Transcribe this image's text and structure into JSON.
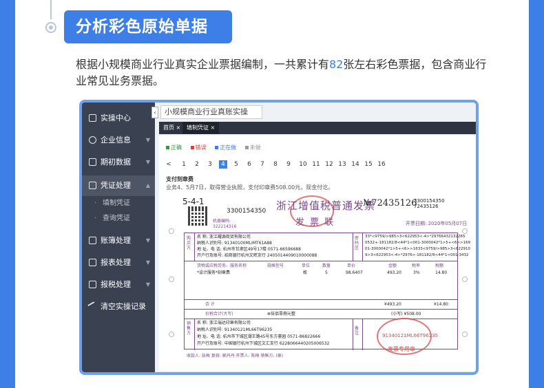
{
  "header": {
    "badge": "分析彩色原始单据",
    "desc_pre": "根据小规模商业行业真实企业票据编制，一共累计有",
    "desc_num": "82",
    "desc_post": "张左右彩色票据，包含商业行业常见业务票据。"
  },
  "app": {
    "tooltip": "小规模商业行业真账实操",
    "collapse_icon": "chevron-left-icon",
    "nav": [
      {
        "label": "实操中心",
        "icon": "check-square-icon"
      },
      {
        "label": "企业信息",
        "icon": "building-icon"
      },
      {
        "label": "期初数据",
        "icon": "bar-chart-icon"
      },
      {
        "label": "凭证处理",
        "icon": "document-icon"
      },
      {
        "label": "账簿处理",
        "icon": "book-icon"
      },
      {
        "label": "报表处理",
        "icon": "line-chart-icon"
      },
      {
        "label": "报税处理",
        "icon": "tax-icon"
      },
      {
        "label": "清空实操记录",
        "icon": "eraser-icon"
      }
    ],
    "nav_sub": [
      "填制凭证",
      "查询凭证"
    ],
    "tabs": [
      {
        "label": "首页 ×"
      },
      {
        "label": "填制凭证 ×"
      }
    ],
    "legend": [
      {
        "label": "正确",
        "color": "#22a33a"
      },
      {
        "label": "错误",
        "color": "#e23b3b"
      },
      {
        "label": "正在做",
        "color": "#3d7fe6"
      },
      {
        "label": "未做",
        "color": "#999999"
      }
    ],
    "pager": {
      "prev": "<",
      "pages": [
        "1",
        "2",
        "3",
        "4",
        "5",
        "6",
        "7",
        "8",
        "9",
        "10",
        "11",
        "12",
        "13",
        "14",
        "15",
        "16"
      ],
      "active": "4"
    },
    "info_title": "支付刻章费",
    "info_text": "业务4、5月7日，取得营业执照，支付印章费508.00元，现金付讫。"
  },
  "invoice": {
    "code_left": "5-4-1",
    "code_num": "3300154350",
    "title": "浙江增值税普通发票",
    "subtitle": "发 票 联",
    "no_label": "№72435126",
    "no_small": "3300154350\n72435126",
    "machine": "机器编码:\n322214316",
    "date": "开票日期: 2020年05月07日",
    "buyer": {
      "name": "名    称: 浙江耀源商贸有限公司",
      "tax": "纳税人识别号: 91340100MLIMT61A88",
      "addr": "地 址、电 话: 杭州市甘肃区49号17楼 0571-66596688",
      "bank": "开户行及账号: 招商银行杭州文晖支行 2405014409010000088"
    },
    "cipher": [
      "33*<9759/>985>3<622953<-4>*29766432132265",
      "0532+-181182/8<44*1<001-3000042*1>5+<6>>169",
      "01-3000042*1>5+<6>>1633<9759/>985>3<622910",
      "9>3<622953<-4>*2976>-181182/8<44*1<001-3432"
    ],
    "columns": [
      "货物或应税劳务、服务名称",
      "规格型号",
      "单位",
      "数量",
      "单价",
      "金额",
      "税率",
      "税额"
    ],
    "row": [
      "*设计服务*刻章费",
      "",
      "枚",
      "5",
      "98.6407",
      "493.20",
      "3%",
      "14.80"
    ],
    "total_label": "合     计",
    "total_amount": "¥493.20",
    "total_tax": "¥14.80",
    "sum_label": "价税合计(大写)",
    "sum_upper": "⊗伍佰零捌元整",
    "sum_lower": "(小写) ¥508.00",
    "seller": {
      "name": "名    称: 浙江瑞达印章有限公司",
      "tax": "纳税人识别号: 91340121ML66T96235",
      "addr": "地 址、电 话: 杭州市下城区潮王路45号东方豪园 0571-86822666",
      "bank": "开户行及账号: 中国银行杭州下城区文汇支行 6228066440205006532"
    },
    "note_label": "备注",
    "seal1_text": "浙江",
    "seal2_text": "91340121ML66T96235",
    "seal2_label": "发票专用章",
    "footer": "收款人: 张梅      复核: 郭丹丹      开票人: 陈梅      销售方: (章)"
  }
}
